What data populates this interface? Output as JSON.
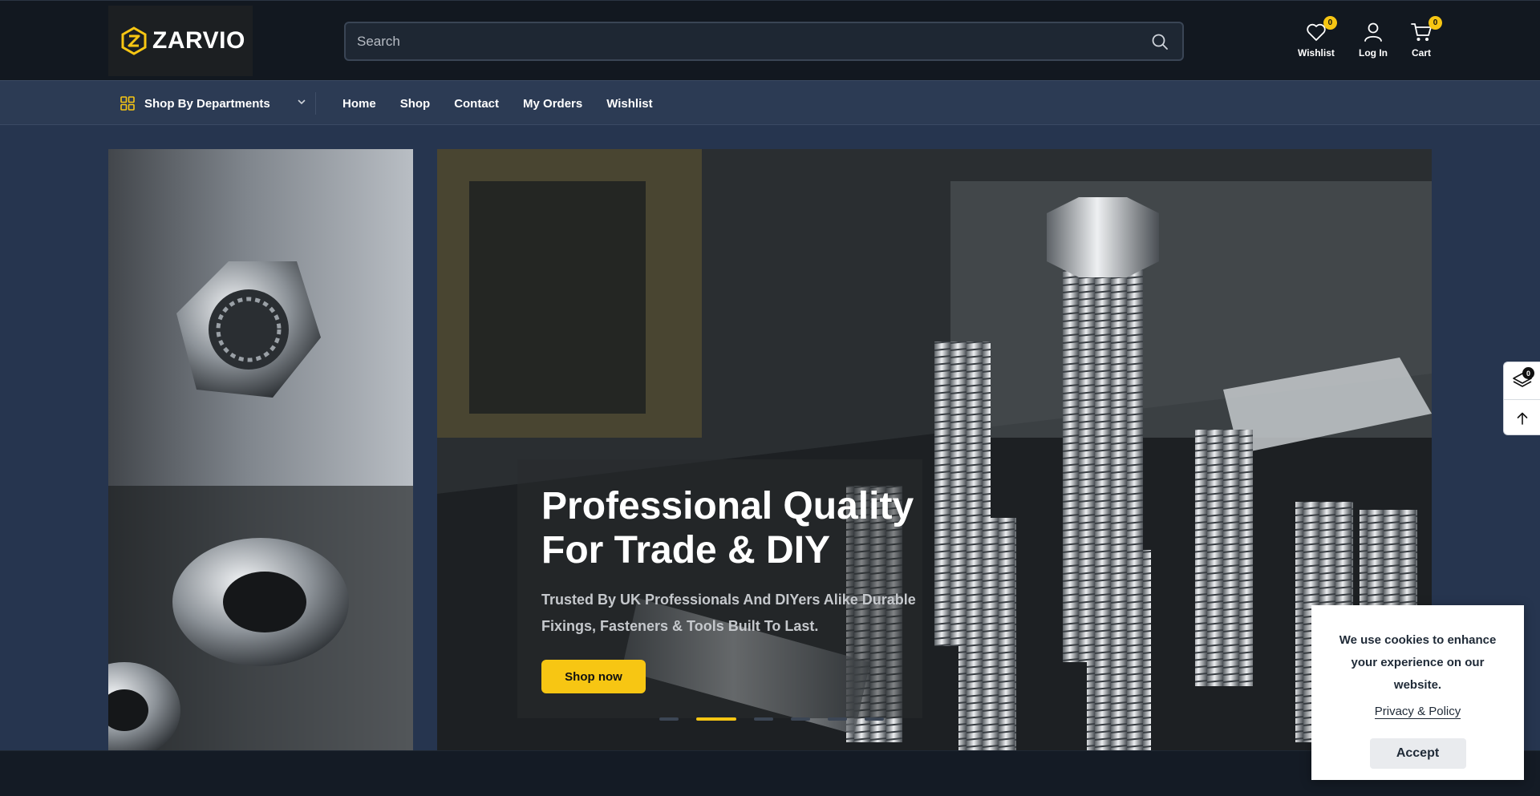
{
  "brand": {
    "name": "ZARVIO",
    "accent": "#f7c613",
    "header_bg": "#121820",
    "nav_bg": "#2c3b54"
  },
  "search": {
    "placeholder": "Search"
  },
  "header_actions": [
    {
      "label": "Wishlist",
      "icon": "heart-icon",
      "count": "0"
    },
    {
      "label": "Log In",
      "icon": "user-icon"
    },
    {
      "label": "Cart",
      "icon": "cart-icon",
      "count": "0"
    }
  ],
  "nav": {
    "departments_label": "Shop By Departments",
    "links": [
      "Home",
      "Shop",
      "Contact",
      "My Orders",
      "Wishlist"
    ]
  },
  "hero": {
    "title": "Professional Quality For Trade & DIY",
    "subtitle": "Trusted By UK Professionals And DIYers Alike Durable Fixings, Fasteners & Tools Built To Last.",
    "cta": "Shop now",
    "slide_count": 6,
    "active_slide": 1
  },
  "floating_tools": {
    "compare_count": "0",
    "compare_icon": "layers-icon",
    "top_icon": "arrow-up-icon"
  },
  "cookie": {
    "message": "We use cookies to enhance your experience on our website.",
    "policy_link": "Privacy & Policy",
    "accept": "Accept"
  }
}
